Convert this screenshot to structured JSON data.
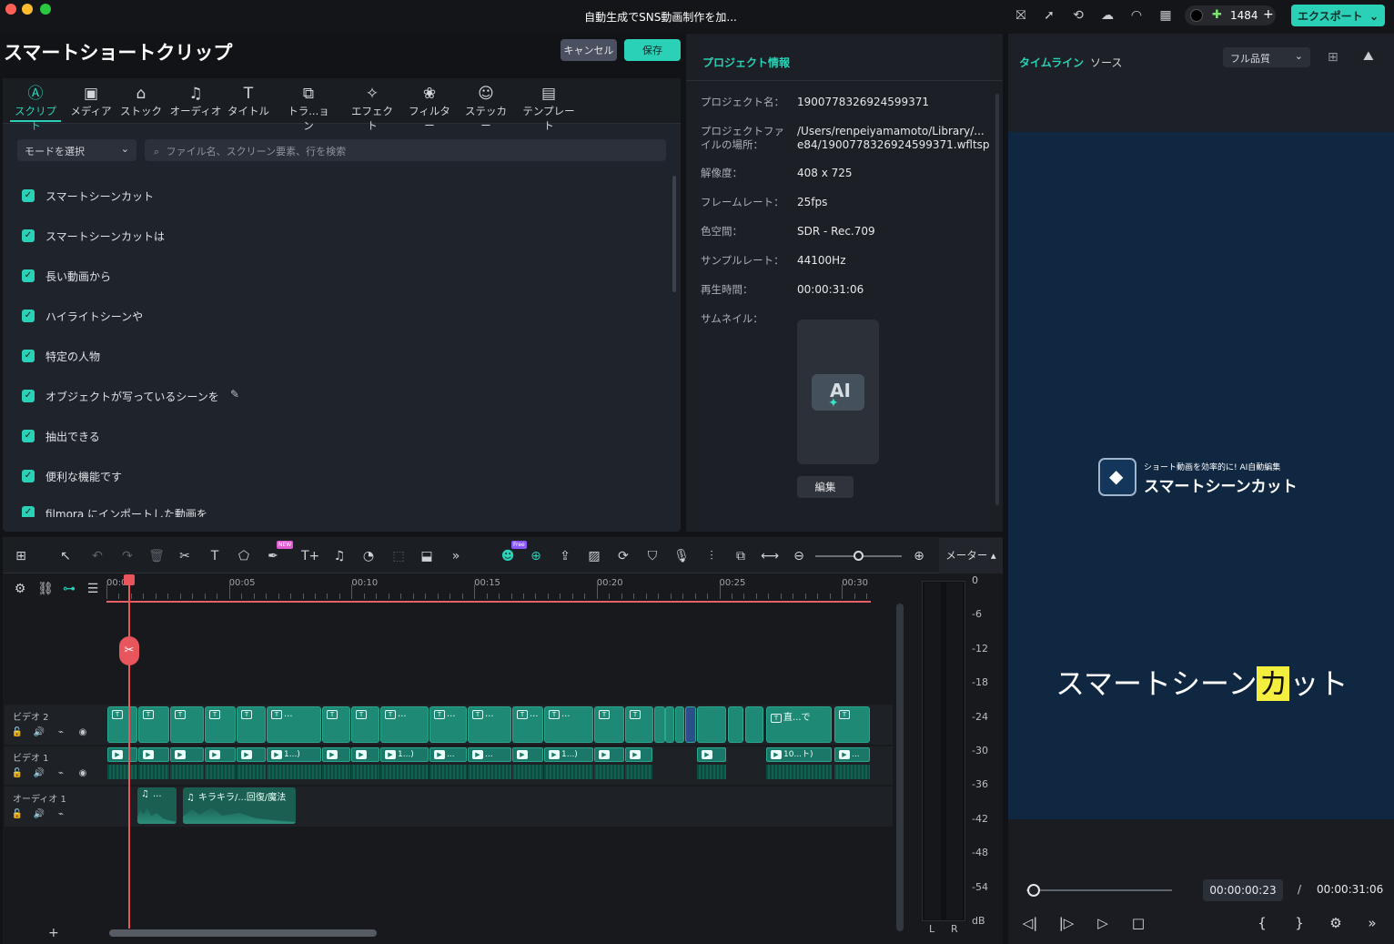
{
  "window": {
    "title": "自動生成でSNS動画制作を加..."
  },
  "titlebar": {
    "credits": "1484",
    "export_label": "エクスポート",
    "export_chevron": "⌄"
  },
  "panel": {
    "title": "スマートショートクリップ",
    "cancel_label": "キャンセル",
    "save_label": "保存"
  },
  "tabs": [
    {
      "label": "スクリプト",
      "icon": "script-icon",
      "glyph": "Ⓐ"
    },
    {
      "label": "メディア",
      "icon": "media-icon",
      "glyph": "▣"
    },
    {
      "label": "ストック",
      "icon": "stock-icon",
      "glyph": "⌂"
    },
    {
      "label": "オーディオ",
      "icon": "music-icon",
      "glyph": "♫"
    },
    {
      "label": "タイトル",
      "icon": "title-icon",
      "glyph": "T"
    },
    {
      "label": "トラ...ョン",
      "icon": "transition-icon",
      "glyph": "⧉"
    },
    {
      "label": "エフェクト",
      "icon": "effect-icon",
      "glyph": "✧"
    },
    {
      "label": "フィルター",
      "icon": "filter-icon",
      "glyph": "❀"
    },
    {
      "label": "ステッカー",
      "icon": "sticker-icon",
      "glyph": "☺"
    },
    {
      "label": "テンプレート",
      "icon": "template-icon",
      "glyph": "▤"
    }
  ],
  "controls": {
    "mode_label": "モードを選択",
    "search_placeholder": "ファイル名、スクリーン要素、行を検索"
  },
  "script_items": [
    "スマートシーンカット",
    "スマートシーンカットは",
    "長い動画から",
    "ハイライトシーンや",
    "特定の人物",
    "オブジェクトが写っているシーンを",
    "抽出できる",
    "便利な機能です",
    "filmora にインポートした動画を"
  ],
  "project": {
    "title": "プロジェクト情報",
    "fields": [
      {
        "label": "プロジェクト名：",
        "value": "1900778326924599371"
      },
      {
        "label": "プロジェクトファ\nイルの場所：",
        "value": "/Users/renpeiyamamoto/Library/...\ne84/1900778326924599371.wfltsp"
      },
      {
        "label": "解像度：",
        "value": "408 x 725"
      },
      {
        "label": "フレームレート：",
        "value": "25fps"
      },
      {
        "label": "色空間：",
        "value": "SDR - Rec.709"
      },
      {
        "label": "サンプルレート：",
        "value": "44100Hz"
      },
      {
        "label": "再生時間：",
        "value": "00:00:31:06"
      },
      {
        "label": "サムネイル：",
        "value": ""
      }
    ],
    "thumbnail_text": "AI",
    "edit_label": "編集"
  },
  "preview": {
    "tab_timeline": "タイムライン",
    "tab_source": "ソース",
    "quality": "フル品質",
    "logo_sub": "ショート動画を効率的に! AI自動編集",
    "logo_main": "スマートシーンカット",
    "caption_before": "スマートシーン",
    "caption_highlight": "カ",
    "caption_after": "ット",
    "current_time": "00:00:00:23",
    "separator": "/",
    "total_time": "00:00:31:06",
    "progress": 0.03
  },
  "timeline": {
    "meter_label": "メーター",
    "ruler": [
      "00:00",
      "00:05",
      "00:10",
      "00:15",
      "00:20",
      "00:25",
      "00:30"
    ],
    "tracks": [
      {
        "name": "ビデオ 2"
      },
      {
        "name": "ビデオ 1"
      },
      {
        "name": "オーディオ 1"
      }
    ],
    "video2_clips": [
      "",
      "",
      "",
      "",
      "",
      "...",
      "",
      "",
      "...",
      "...",
      "...",
      "...",
      "...",
      "",
      "",
      "直...で",
      ""
    ],
    "video1_clips": [
      "",
      "",
      "",
      "",
      "",
      "1...)",
      "",
      "",
      "1...)",
      "...",
      "...",
      "",
      "1...)",
      "",
      "",
      "",
      "10...ト)",
      "..."
    ],
    "audio_clips": [
      "...",
      "キラキラ/...回復/魔法"
    ],
    "free_badge": "Free",
    "new_badge": "NEW"
  },
  "meter": {
    "scale": [
      "0",
      "-6",
      "-12",
      "-18",
      "-24",
      "-30",
      "-36",
      "-42",
      "-48",
      "-54",
      "dB"
    ],
    "left": "L",
    "right": "R"
  }
}
